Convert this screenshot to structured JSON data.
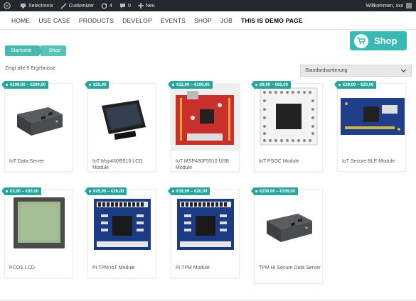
{
  "admin_bar": {
    "site_name": "Xelectronix",
    "customize": "Customizer",
    "updates_count": "4",
    "comments_count": "0",
    "new_label": "Neu",
    "greeting": "Willkommen, xxx"
  },
  "nav": {
    "items": [
      "HOME",
      "USE CASE",
      "PRODUCTS",
      "DEVELOP",
      "EVENTS",
      "SHOP",
      "JOB",
      "THIS IS DEMO PAGE"
    ]
  },
  "shop_badge": {
    "label": "Shop"
  },
  "breadcrumb": {
    "home": "Startseite",
    "current": "Shop"
  },
  "results": {
    "count_text": "Zeigt alle 9 Ergebnisse"
  },
  "sort": {
    "selected": "Standardsortierung"
  },
  "products": [
    {
      "price": "€199,00 – €299,00",
      "title": "IoT Data Server",
      "image": "grey-box-device"
    },
    {
      "price": "€25,00",
      "title": "IoT Msp430f5510 LCD Module",
      "image": "lcd-module"
    },
    {
      "price": "€12,00 – €100,00",
      "title": "IoT MSP430F5510 USB Module",
      "image": "red-pcb"
    },
    {
      "price": "€9,00 – €60,00",
      "title": "IoT PSOC Module",
      "image": "white-pcb-chip"
    },
    {
      "price": "€19,00 – €20,00",
      "title": "IoT Secure BLE Module",
      "image": "blue-ble-pcb"
    },
    {
      "price": "€3,00 – €30,00",
      "title": "PCOS LCD",
      "image": "plain-lcd"
    },
    {
      "price": "€25,00 – €26,00",
      "title": "Pi TPM IoT Module",
      "image": "blue-tpm-pcb"
    },
    {
      "price": "€18,00 – €20,00",
      "title": "Pi TPM Module",
      "image": "blue-tpm-pcb"
    },
    {
      "price": "€239,00 – €339,00",
      "title": "TPM Hi Secure Data Server",
      "image": "grey-box-device"
    }
  ],
  "colors": {
    "accent": "#39b9b2",
    "price_tag": "#2aa59d",
    "admin_bar": "#23282d"
  }
}
